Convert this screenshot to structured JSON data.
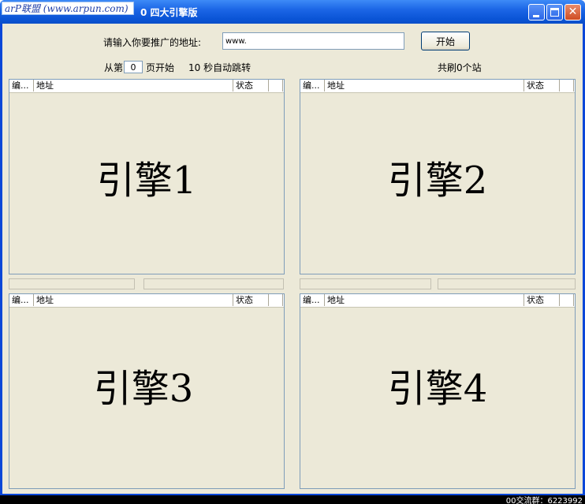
{
  "window": {
    "brand": "arP联盟 (www.arpun.com)",
    "title": "0  四大引擎版",
    "close_glyph": "✕"
  },
  "form": {
    "url_label": "请输入你要推广的地址:",
    "url_value": "www.",
    "start_button": "开始",
    "from_label": "从第",
    "page_value": "0",
    "page_start_label": "页开始",
    "auto_jump_label": "10 秒自动跳转",
    "total_label": "共刷0个站"
  },
  "columns": {
    "num": "编...",
    "address": "地址",
    "status": "状态",
    "extra": ""
  },
  "engines": [
    {
      "label": "引擎1"
    },
    {
      "label": "引擎2"
    },
    {
      "label": "引擎3"
    },
    {
      "label": "引擎4"
    }
  ],
  "statusbar": {
    "text": "00交流群：6223992"
  },
  "colors": {
    "titlebar": "#0a54d6",
    "client": "#ece9d8",
    "listview_border": "#7f9db9"
  }
}
